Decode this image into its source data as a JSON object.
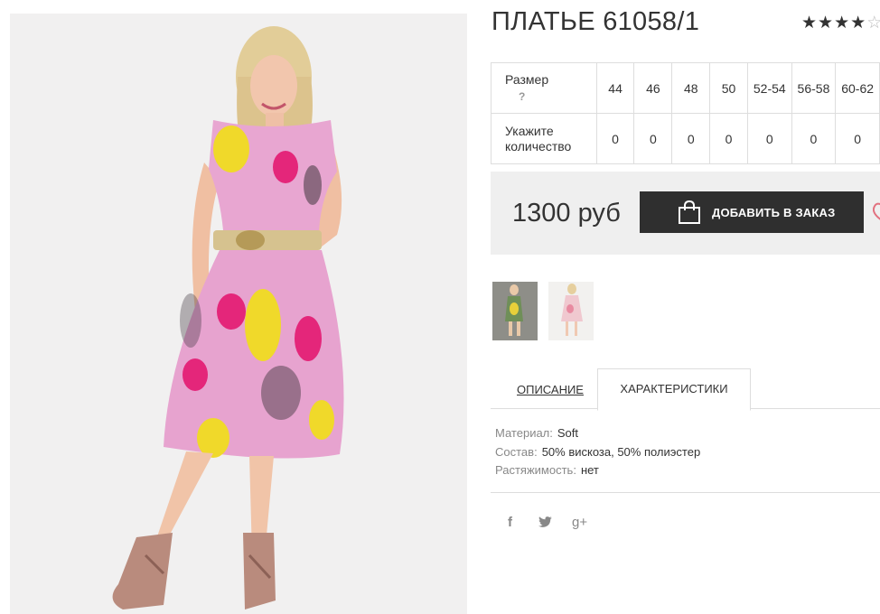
{
  "product": {
    "title": "ПЛАТЬЕ 61058/1",
    "rating_stars": 4,
    "rating_max": 5,
    "star_filled": "★",
    "star_empty": "☆"
  },
  "size_table": {
    "size_label": "Размер",
    "help_mark": "?",
    "qty_label_line1": "Укажите",
    "qty_label_line2": "количество",
    "sizes": [
      "44",
      "46",
      "48",
      "50",
      "52-54",
      "56-58",
      "60-62"
    ],
    "quantities": [
      "0",
      "0",
      "0",
      "0",
      "0",
      "0",
      "0"
    ]
  },
  "purchase": {
    "price": "1300 руб",
    "add_button": "ДОБАВИТЬ В ЗАКАЗ",
    "bag_icon": "shopping-bag-icon",
    "heart_icon": "heart-icon"
  },
  "tabs": {
    "description": "ОПИСАНИЕ",
    "characteristics": "ХАРАКТЕРИСТИКИ"
  },
  "specs": [
    {
      "key": "Материал:",
      "value": "Soft"
    },
    {
      "key": "Состав:",
      "value": "50% вискоза, 50% полиэстер"
    },
    {
      "key": "Растяжимость:",
      "value": "нет"
    }
  ],
  "social": {
    "facebook": "f",
    "twitter": "twitter-bird",
    "googleplus": "g+"
  },
  "colors": {
    "button_bg": "#2f2f2f",
    "price_box_bg": "#efefef",
    "heart": "#e2717f",
    "dress_pink": "#e8a6d1",
    "dress_yellow": "#f0d92a",
    "dress_magenta": "#e4267a"
  }
}
